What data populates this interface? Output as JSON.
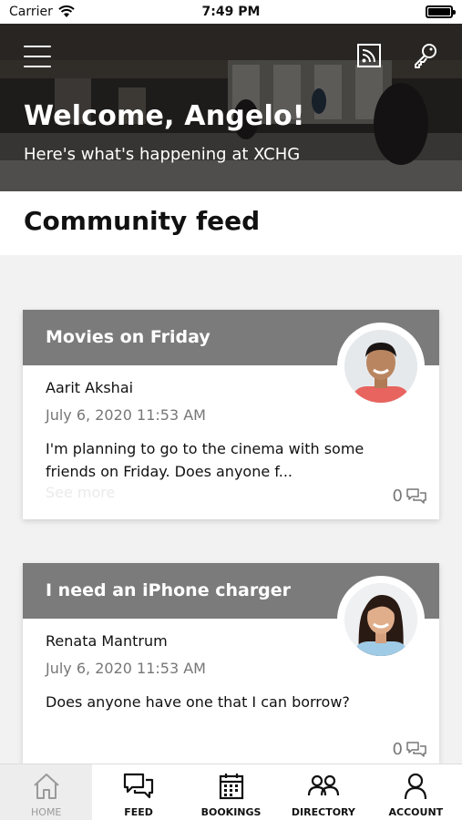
{
  "status_bar": {
    "carrier": "Carrier",
    "time": "7:49 PM"
  },
  "hero": {
    "welcome": "Welcome, Angelo!",
    "subtitle": "Here's what's happening at XCHG"
  },
  "feed": {
    "title": "Community feed"
  },
  "posts": [
    {
      "title": "Movies on Friday",
      "author": "Aarit Akshai",
      "date": "July 6, 2020 11:53 AM",
      "body": "I'm planning to go to the cinema with some friends on Friday. Does anyone f...",
      "see_more": "See more",
      "comments": "0"
    },
    {
      "title": "I need an iPhone charger",
      "author": "Renata Mantrum",
      "date": "July 6, 2020 11:53 AM",
      "body": "Does anyone have one that I can borrow?",
      "comments": "0"
    }
  ],
  "nav": {
    "home": "HOME",
    "feed": "FEED",
    "bookings": "BOOKINGS",
    "directory": "DIRECTORY",
    "account": "ACCOUNT"
  },
  "colors": {
    "card_header": "#7b7b7b",
    "active_nav": "#ededed"
  }
}
